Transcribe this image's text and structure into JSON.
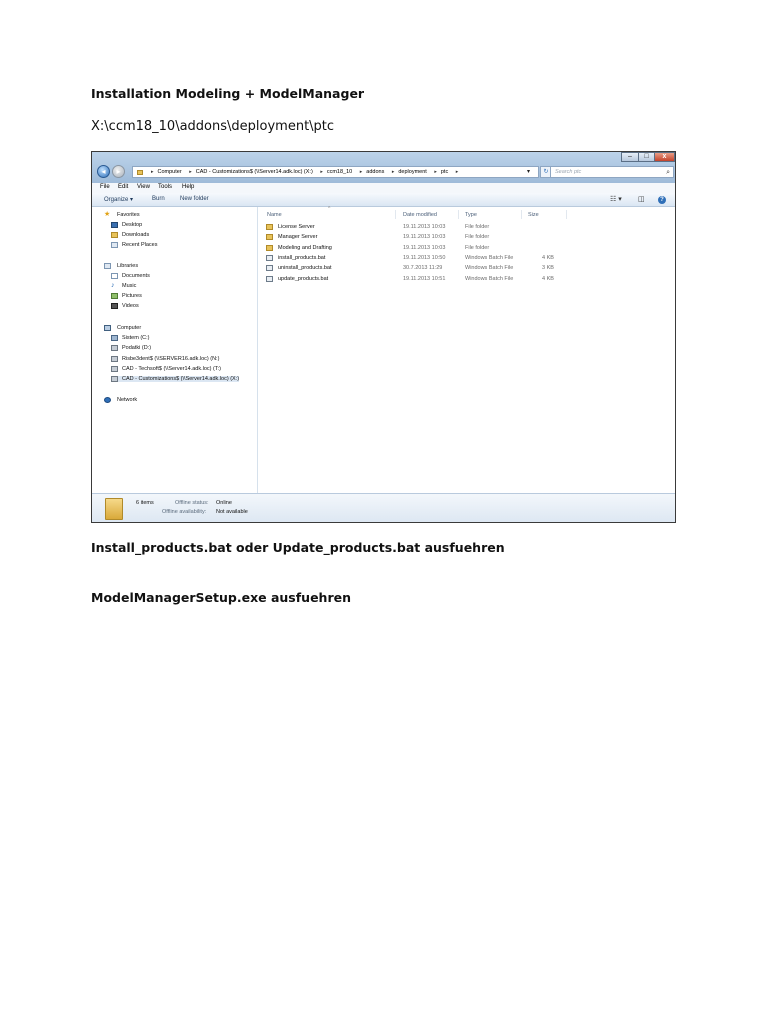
{
  "doc": {
    "heading": "Installation Modeling + ModelManager",
    "path": "X:\\ccm18_10\\addons\\deployment\\ptc",
    "step1": "Install_products.bat  oder Update_products.bat ausfuehren",
    "step2": "ModelManagerSetup.exe ausfuehren"
  },
  "explorer": {
    "window_controls": {
      "minimize": "–",
      "maximize": "□",
      "close": "x"
    },
    "address": [
      "Computer",
      "CAD - Customizations$ (\\\\Server14.adk.loc) (X:)",
      "ccm18_10",
      "addons",
      "deployment",
      "ptc"
    ],
    "search_placeholder": "Search ptc",
    "menu": [
      "File",
      "Edit",
      "View",
      "Tools",
      "Help"
    ],
    "toolbar": {
      "organize": "Organize ▾",
      "burn": "Burn",
      "new_folder": "New folder"
    },
    "nav": {
      "favorites": "Favorites",
      "desktop": "Desktop",
      "downloads": "Downloads",
      "recent_places": "Recent Places",
      "libraries": "Libraries",
      "documents": "Documents",
      "music": "Music",
      "pictures": "Pictures",
      "videos": "Videos",
      "computer": "Computer",
      "drive_c": "Sistem (C:)",
      "drive_d": "Podatki (D:)",
      "drive_n": "Risbe3dent$ (\\\\SERVER16.adk.loc) (N:)",
      "drive_t": "CAD - Techsoft$ (\\\\Server14.adk.loc) (T:)",
      "drive_x": "CAD - Customizations$ (\\\\Server14.adk.loc) (X:)",
      "network": "Network"
    },
    "columns": {
      "name": "Name",
      "date": "Date modified",
      "type": "Type",
      "size": "Size"
    },
    "files": [
      {
        "name": "License Server",
        "date": "19.11.2013 10:03",
        "type": "File folder",
        "size": "",
        "kind": "folder"
      },
      {
        "name": "Manager Server",
        "date": "19.11.2013 10:03",
        "type": "File folder",
        "size": "",
        "kind": "folder"
      },
      {
        "name": "Modeling and Drafting",
        "date": "19.11.2013 10:03",
        "type": "File folder",
        "size": "",
        "kind": "folder"
      },
      {
        "name": "install_products.bat",
        "date": "19.11.2013 10:50",
        "type": "Windows Batch File",
        "size": "4 KB",
        "kind": "bat"
      },
      {
        "name": "uninstall_products.bat",
        "date": "30.7.2013 11:29",
        "type": "Windows Batch File",
        "size": "3 KB",
        "kind": "bat"
      },
      {
        "name": "update_products.bat",
        "date": "19.11.2013 10:51",
        "type": "Windows Batch File",
        "size": "4 KB",
        "kind": "bat"
      }
    ],
    "details": {
      "count": "6 items",
      "offline_status_label": "Offline status:",
      "offline_status_value": "Online",
      "offline_avail_label": "Offline availability:",
      "offline_avail_value": "Not available"
    }
  }
}
